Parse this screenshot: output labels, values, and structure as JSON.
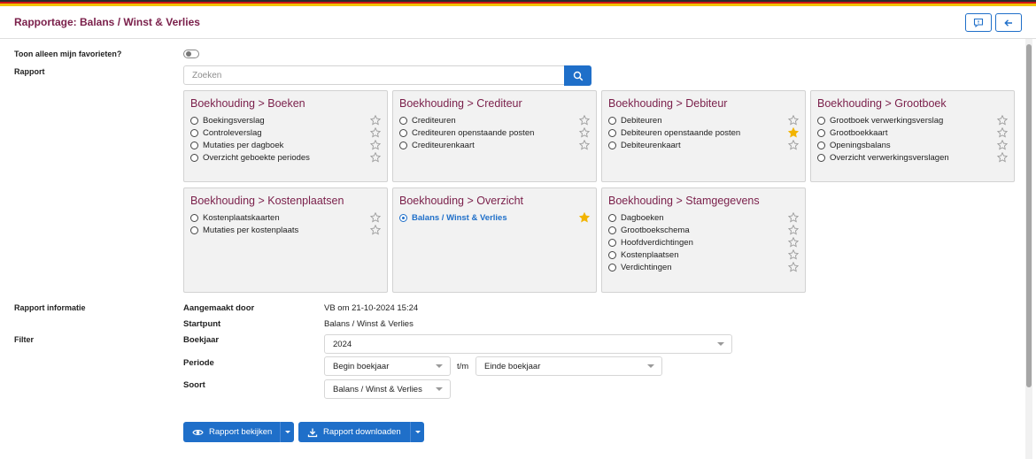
{
  "page": {
    "title": "Rapportage: Balans / Winst & Verlies"
  },
  "favorites": {
    "label": "Toon alleen mijn favorieten?"
  },
  "report": {
    "label": "Rapport",
    "search_placeholder": "Zoeken",
    "groups": [
      {
        "title": "Boekhouding > Boeken",
        "items": [
          {
            "label": "Boekingsverslag",
            "selected": false,
            "favorite": false
          },
          {
            "label": "Controleverslag",
            "selected": false,
            "favorite": false
          },
          {
            "label": "Mutaties per dagboek",
            "selected": false,
            "favorite": false
          },
          {
            "label": "Overzicht geboekte periodes",
            "selected": false,
            "favorite": false
          }
        ]
      },
      {
        "title": "Boekhouding > Crediteur",
        "items": [
          {
            "label": "Crediteuren",
            "selected": false,
            "favorite": false
          },
          {
            "label": "Crediteuren openstaande posten",
            "selected": false,
            "favorite": false
          },
          {
            "label": "Crediteurenkaart",
            "selected": false,
            "favorite": false
          }
        ]
      },
      {
        "title": "Boekhouding > Debiteur",
        "items": [
          {
            "label": "Debiteuren",
            "selected": false,
            "favorite": false
          },
          {
            "label": "Debiteuren openstaande posten",
            "selected": false,
            "favorite": true
          },
          {
            "label": "Debiteurenkaart",
            "selected": false,
            "favorite": false
          }
        ]
      },
      {
        "title": "Boekhouding > Grootboek",
        "items": [
          {
            "label": "Grootboek verwerkingsverslag",
            "selected": false,
            "favorite": false
          },
          {
            "label": "Grootboekkaart",
            "selected": false,
            "favorite": false
          },
          {
            "label": "Openingsbalans",
            "selected": false,
            "favorite": false
          },
          {
            "label": "Overzicht verwerkingsverslagen",
            "selected": false,
            "favorite": false
          }
        ]
      },
      {
        "title": "Boekhouding > Kostenplaatsen",
        "items": [
          {
            "label": "Kostenplaatskaarten",
            "selected": false,
            "favorite": false
          },
          {
            "label": "Mutaties per kostenplaats",
            "selected": false,
            "favorite": false
          }
        ]
      },
      {
        "title": "Boekhouding > Overzicht",
        "items": [
          {
            "label": "Balans / Winst & Verlies",
            "selected": true,
            "favorite": true
          }
        ]
      },
      {
        "title": "Boekhouding > Stamgegevens",
        "items": [
          {
            "label": "Dagboeken",
            "selected": false,
            "favorite": false
          },
          {
            "label": "Grootboekschema",
            "selected": false,
            "favorite": false
          },
          {
            "label": "Hoofdverdichtingen",
            "selected": false,
            "favorite": false
          },
          {
            "label": "Kostenplaatsen",
            "selected": false,
            "favorite": false
          },
          {
            "label": "Verdichtingen",
            "selected": false,
            "favorite": false
          }
        ]
      }
    ]
  },
  "info": {
    "label": "Rapport informatie",
    "created_by_label": "Aangemaakt door",
    "created_by_value": "VB om 21-10-2024 15:24",
    "start_label": "Startpunt",
    "start_value": "Balans / Winst & Verlies"
  },
  "filter": {
    "label": "Filter",
    "year_label": "Boekjaar",
    "year_value": "2024",
    "period_label": "Periode",
    "period_from": "Begin boekjaar",
    "period_sep": "t/m",
    "period_to": "Einde boekjaar",
    "type_label": "Soort",
    "type_value": "Balans / Winst & Verlies"
  },
  "actions": {
    "view_label": "Rapport bekijken",
    "download_label": "Rapport downloaden"
  },
  "colors": {
    "accent": "#1f6fc9",
    "title": "#7a1f4a",
    "favorite": "#f2b400"
  }
}
